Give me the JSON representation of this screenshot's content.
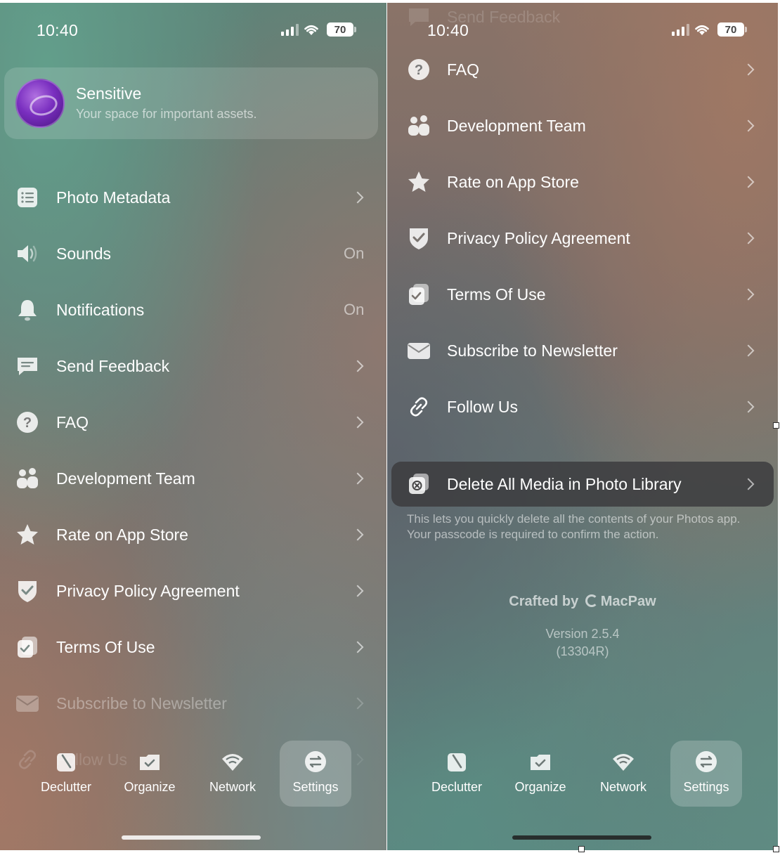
{
  "status_bar": {
    "time": "10:40",
    "battery": "70"
  },
  "profile": {
    "title": "Sensitive",
    "subtitle": "Your space for important assets."
  },
  "settings_items": [
    {
      "label": "Photo Metadata"
    },
    {
      "label": "Sounds",
      "value": "On"
    },
    {
      "label": "Notifications",
      "value": "On"
    },
    {
      "label": "Send Feedback"
    },
    {
      "label": "FAQ"
    },
    {
      "label": "Development Team"
    },
    {
      "label": "Rate on App Store"
    },
    {
      "label": "Privacy Policy Agreement"
    },
    {
      "label": "Terms Of Use"
    },
    {
      "label": "Subscribe to Newsletter"
    },
    {
      "label": "Follow Us"
    }
  ],
  "danger": {
    "label": "Delete All Media in Photo Library",
    "description": "This lets you quickly delete all the contents of your Photos app. Your passcode is required to confirm the action."
  },
  "footer": {
    "crafted_prefix": "Crafted by",
    "brand": "MacPaw",
    "version": "Version 2.5.4",
    "build": "(13304R)"
  },
  "tabs": [
    {
      "label": "Declutter",
      "icon": "declutter-icon"
    },
    {
      "label": "Organize",
      "icon": "organize-icon"
    },
    {
      "label": "Network",
      "icon": "network-icon"
    },
    {
      "label": "Settings",
      "icon": "settings-icon",
      "active": true
    }
  ],
  "colors": {
    "left_accent": "#5e8378",
    "right_accent": "#8a7368",
    "danger_row": "#3c3c3e"
  }
}
